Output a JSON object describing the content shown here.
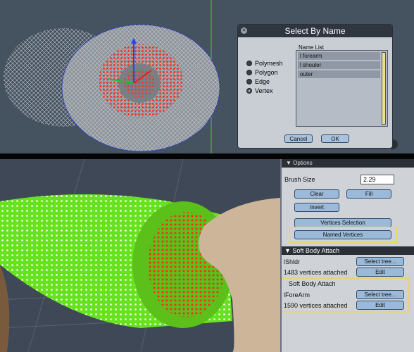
{
  "dialog": {
    "title": "Select By Name",
    "close_icon": "close-icon",
    "modes": [
      {
        "label": "Polymesh",
        "selected": false
      },
      {
        "label": "Polygon",
        "selected": false
      },
      {
        "label": "Edge",
        "selected": false
      },
      {
        "label": "Vertex",
        "selected": true
      }
    ],
    "name_list_label": "Name List",
    "names": [
      "l forearm",
      "l shouler",
      "outer"
    ],
    "cancel_label": "Cancel",
    "ok_label": "OK"
  },
  "panel": {
    "options_header": "Options",
    "brush_size_label": "Brush Size",
    "brush_size_value": "2.29",
    "clear_label": "Clear",
    "fill_label": "Fill",
    "invert_label": "Invert",
    "vertices_selection_label": "Vertices Selection",
    "named_vertices_label": "Named Vertices",
    "soft_body_header": "Soft Body Attach",
    "attach1_name": "lShldr",
    "attach1_select": "Select tree...",
    "attach1_count": "1483 vertices attached",
    "attach1_edit": "Edit",
    "soft_body_subheader": "Soft Body Attach",
    "attach2_name": "lForeArm",
    "attach2_select": "Select tree...",
    "attach2_count": "1590 vertices attached",
    "attach2_edit": "Edit"
  },
  "colors": {
    "highlight": "#e8d56a",
    "selection": "#ff2a1a",
    "mesh_green": "#66e21f"
  }
}
